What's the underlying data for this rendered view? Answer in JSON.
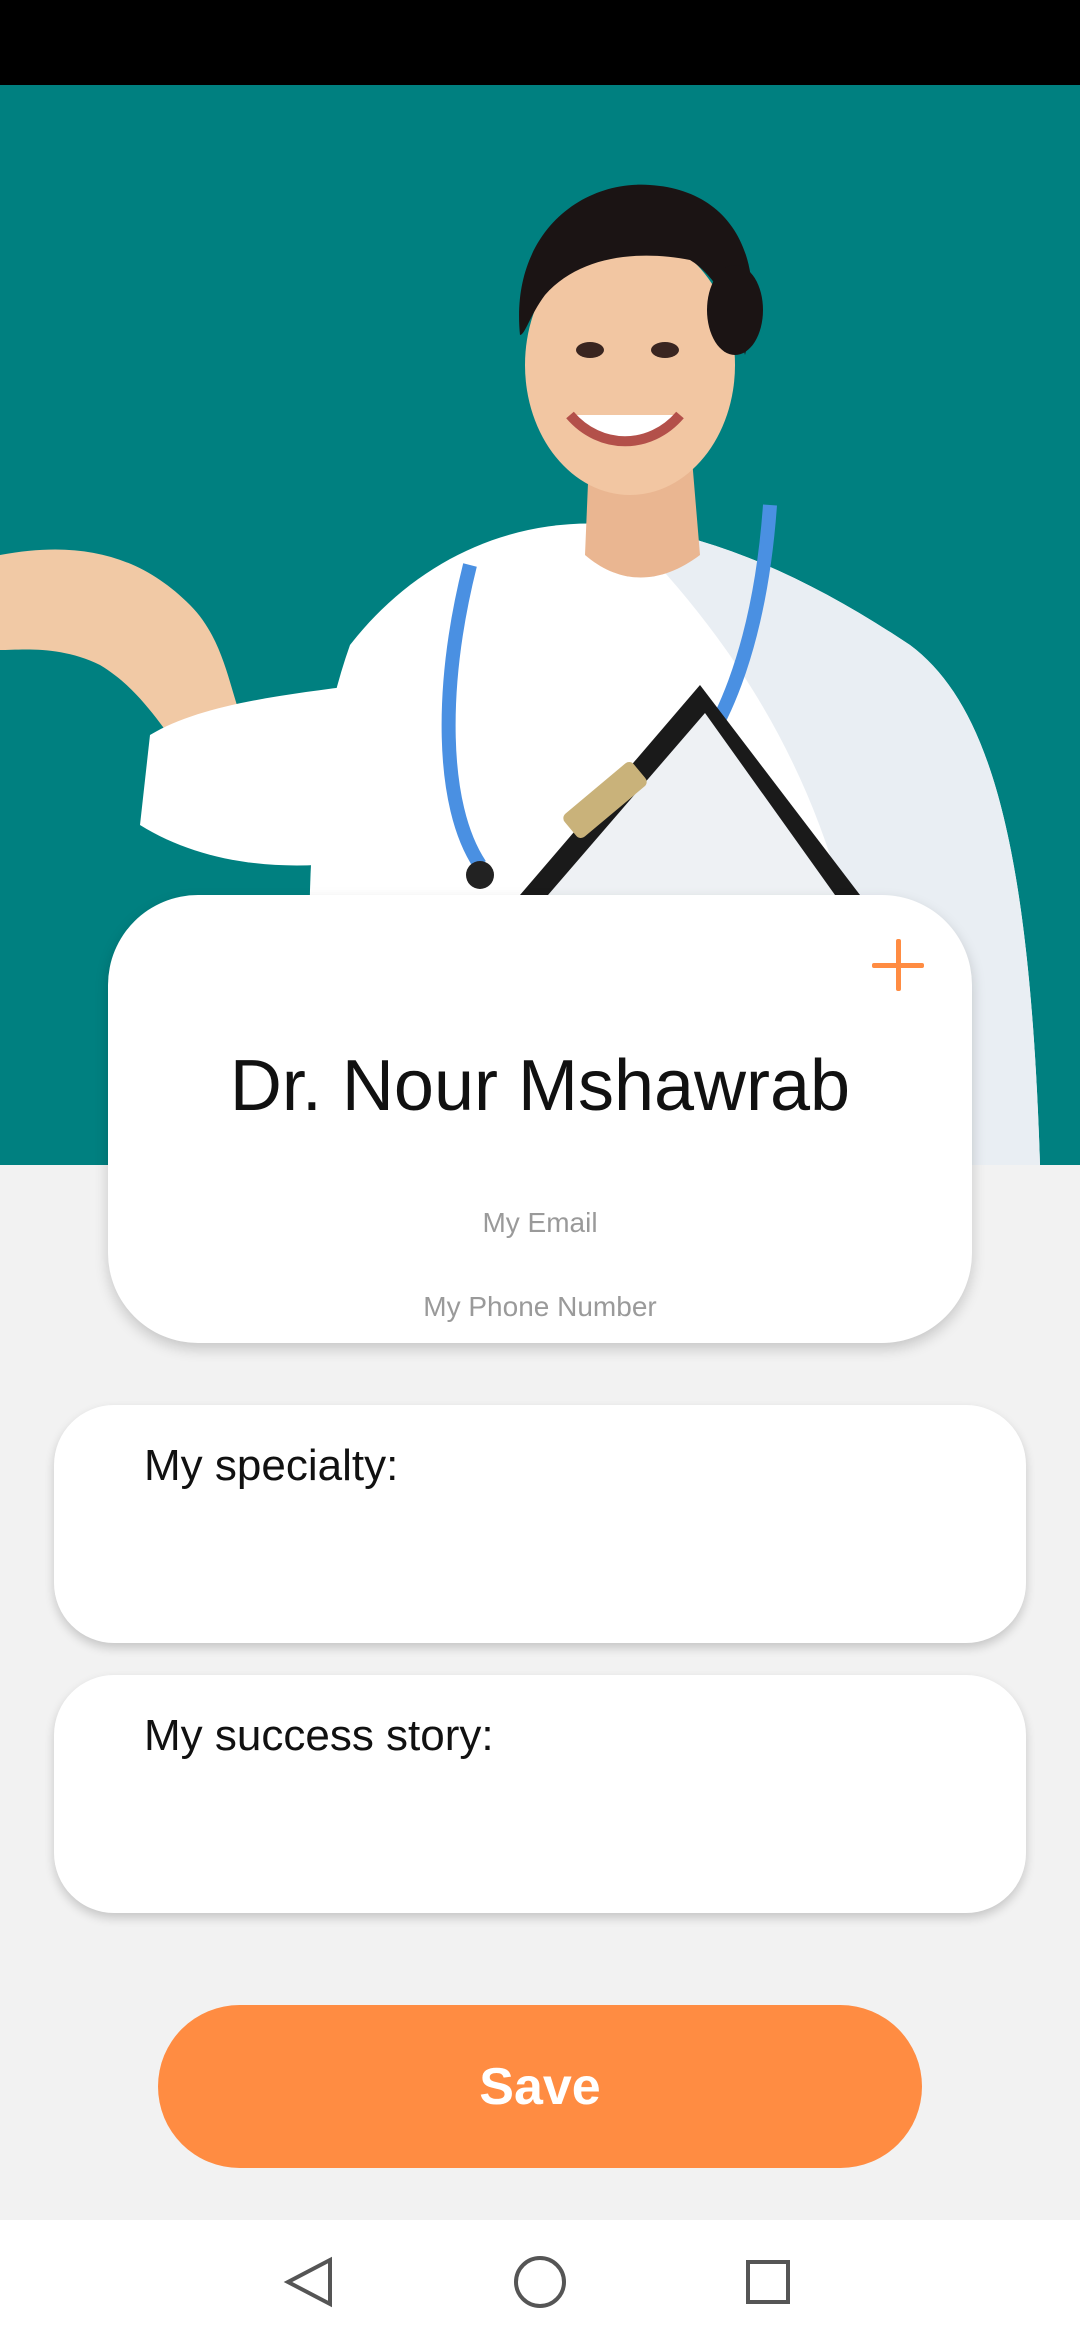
{
  "profile": {
    "name": "Dr. Nour Mshawrab",
    "email_placeholder": "My Email",
    "phone_placeholder": "My Phone Number",
    "add_icon": "plus-icon"
  },
  "sections": {
    "specialty_label": "My specialty:",
    "success_story_label": "My success story:"
  },
  "actions": {
    "save_label": "Save"
  },
  "nav": {
    "back_icon": "triangle-back-icon",
    "home_icon": "circle-home-icon",
    "recents_icon": "square-recents-icon"
  },
  "colors": {
    "header": "#008080",
    "accent": "#ff8c42",
    "background": "#f2f2f2",
    "card": "#ffffff"
  }
}
